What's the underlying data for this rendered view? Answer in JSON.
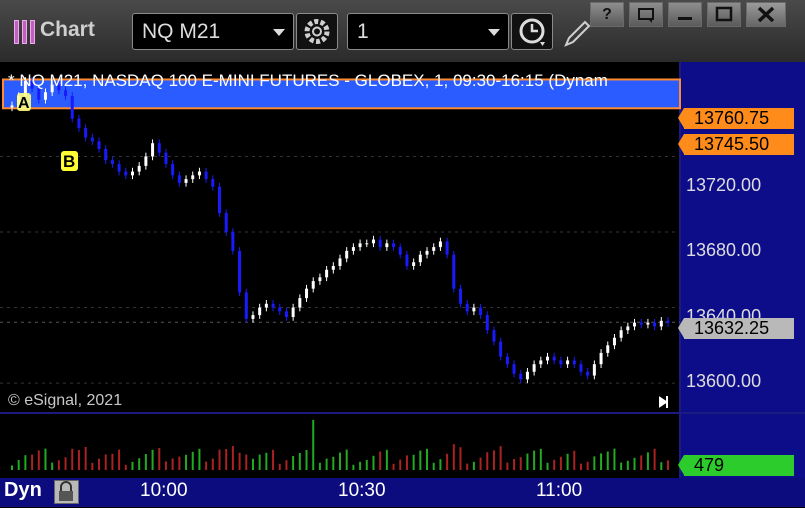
{
  "window": {
    "app_title": "Chart",
    "symbol": "NQ M21",
    "interval": "1",
    "buttons": {
      "help": "?",
      "restore": "□",
      "minimize": "—",
      "maximize": "□",
      "close": "✕"
    }
  },
  "chart_header": "* NQ M21, NASDAQ 100 E-MINI FUTURES - GLOBEX, 1, 09:30-16:15 (Dynam",
  "copyright": "© eSignal, 2021",
  "price_axis": {
    "ticks": [
      "13720.00",
      "13680.00",
      "13640.00",
      "13600.00"
    ],
    "tick_values": [
      13720,
      13680,
      13640,
      13600
    ]
  },
  "tags": {
    "upper": "13760.75",
    "lower": "13745.50",
    "last": "13632.25",
    "volume": "479"
  },
  "markers": {
    "a": "A",
    "b": "B"
  },
  "time_axis": {
    "labels": [
      "10:00",
      "10:30",
      "11:00"
    ],
    "mode": "Dyn"
  },
  "colors": {
    "band": "#2a5cff",
    "band_border": "#ff8a30",
    "tag_orange": "#ff8c1a",
    "tag_last": "#b9b9b9",
    "tag_volume": "#2dcc2d",
    "up_candle": "#ffffff",
    "down_candle": "#1a1aff",
    "time_bar": "#0c0c7e"
  },
  "chart_data": {
    "type": "candlestick",
    "ylim": [
      13590,
      13770
    ],
    "band": [
      13745.5,
      13760.75
    ],
    "last": 13632.25,
    "volume_last": 479,
    "closes": [
      13747,
      13752,
      13760,
      13756,
      13750,
      13754,
      13758,
      13755,
      13752,
      13740,
      13735,
      13730,
      13728,
      13724,
      13718,
      13716,
      13712,
      13710,
      13712,
      13715,
      13720,
      13727,
      13722,
      13716,
      13710,
      13706,
      13708,
      13710,
      13712,
      13708,
      13704,
      13690,
      13680,
      13670,
      13648,
      13634,
      13636,
      13640,
      13642,
      13640,
      13638,
      13635,
      13640,
      13645,
      13650,
      13654,
      13656,
      13660,
      13662,
      13666,
      13670,
      13672,
      13674,
      13674,
      13676,
      13672,
      13674,
      13672,
      13668,
      13662,
      13664,
      13668,
      13670,
      13672,
      13675,
      13668,
      13650,
      13642,
      13638,
      13640,
      13636,
      13628,
      13622,
      13614,
      13610,
      13605,
      13602,
      13606,
      13610,
      13612,
      13614,
      13612,
      13610,
      13612,
      13610,
      13606,
      13604,
      13610,
      13616,
      13620,
      13624,
      13628,
      13630,
      13632,
      13631,
      13632,
      13630,
      13633,
      13632
    ]
  }
}
